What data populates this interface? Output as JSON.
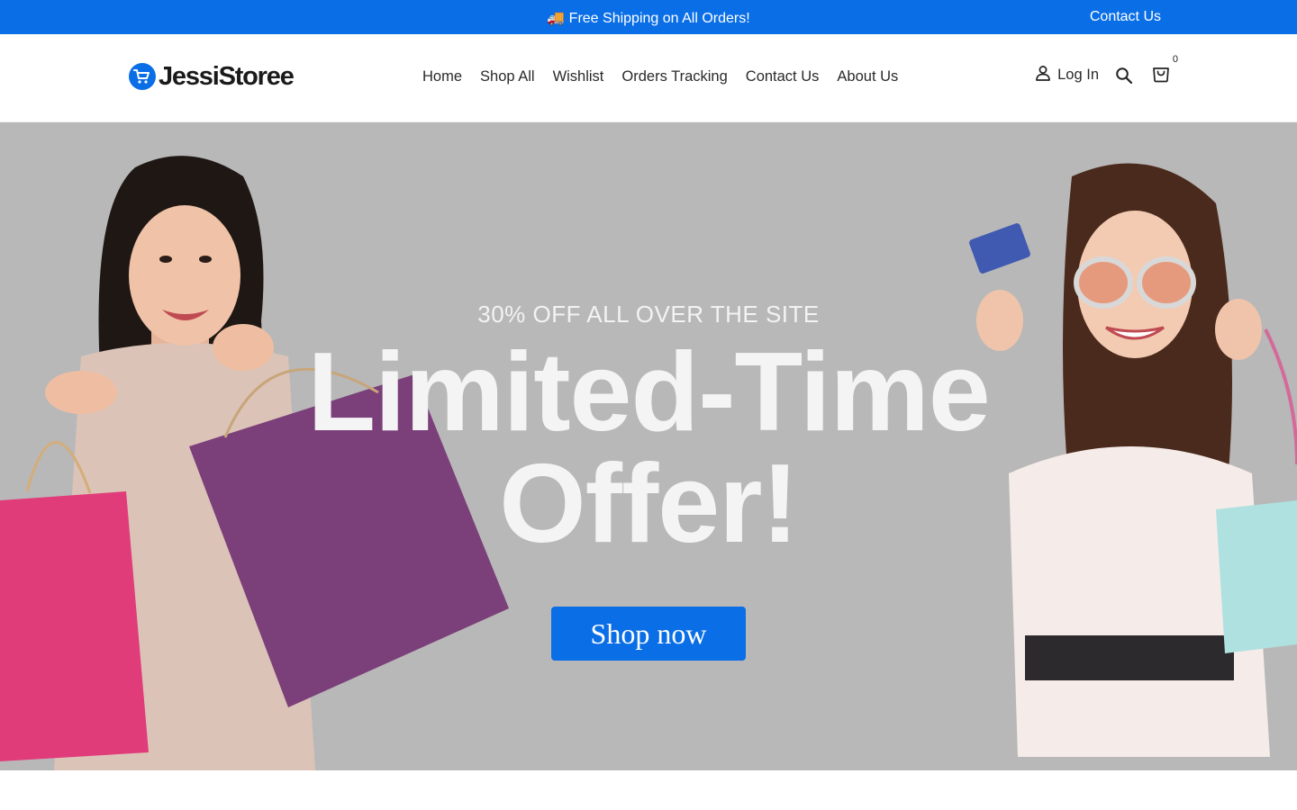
{
  "announcement": {
    "text": "🚚 Free Shipping on All Orders!",
    "contact_label": "Contact Us"
  },
  "header": {
    "logo_text": "JessiStoree",
    "nav": [
      "Home",
      "Shop All",
      "Wishlist",
      "Orders Tracking",
      "Contact Us",
      "About Us"
    ],
    "login_label": "Log In",
    "cart_count": "0",
    "icons": [
      "cart-logo-icon",
      "user-icon",
      "search-icon",
      "bag-icon"
    ]
  },
  "hero": {
    "promo": "30% OFF ALL OVER THE SITE",
    "headline_line1": "Limited-Time",
    "headline_line2": "Offer!",
    "cta_label": "Shop now"
  },
  "colors": {
    "accent": "#0a6ee6",
    "hero_bg": "#b8b8b8",
    "text": "#2a2a2a"
  }
}
